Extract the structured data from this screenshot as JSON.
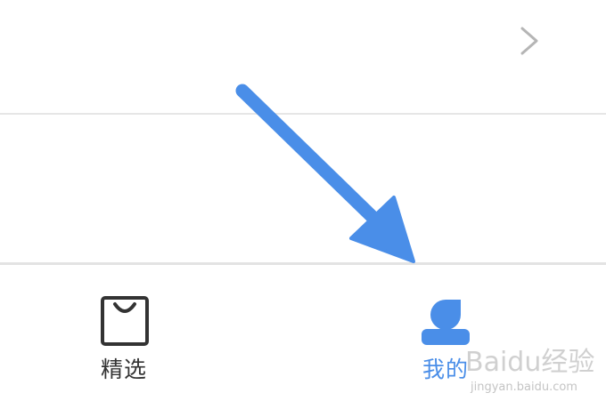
{
  "list": {
    "rows": [
      {
        "icon": "chevron-right-icon"
      },
      {
        "icon": "chevron-right-icon"
      }
    ]
  },
  "tabbar": {
    "featured": {
      "label": "精选",
      "icon": "shopping-bag-icon",
      "color": "#333333"
    },
    "mine": {
      "label": "我的",
      "icon": "profile-icon",
      "color": "#4a8ee8",
      "selected": true
    }
  },
  "watermark": {
    "text": "Baidu经验",
    "sub": "jingyan.baidu.com"
  },
  "overlay": {
    "arrow_color": "#4a8ee8",
    "icon": "arrow-pointer-icon"
  }
}
